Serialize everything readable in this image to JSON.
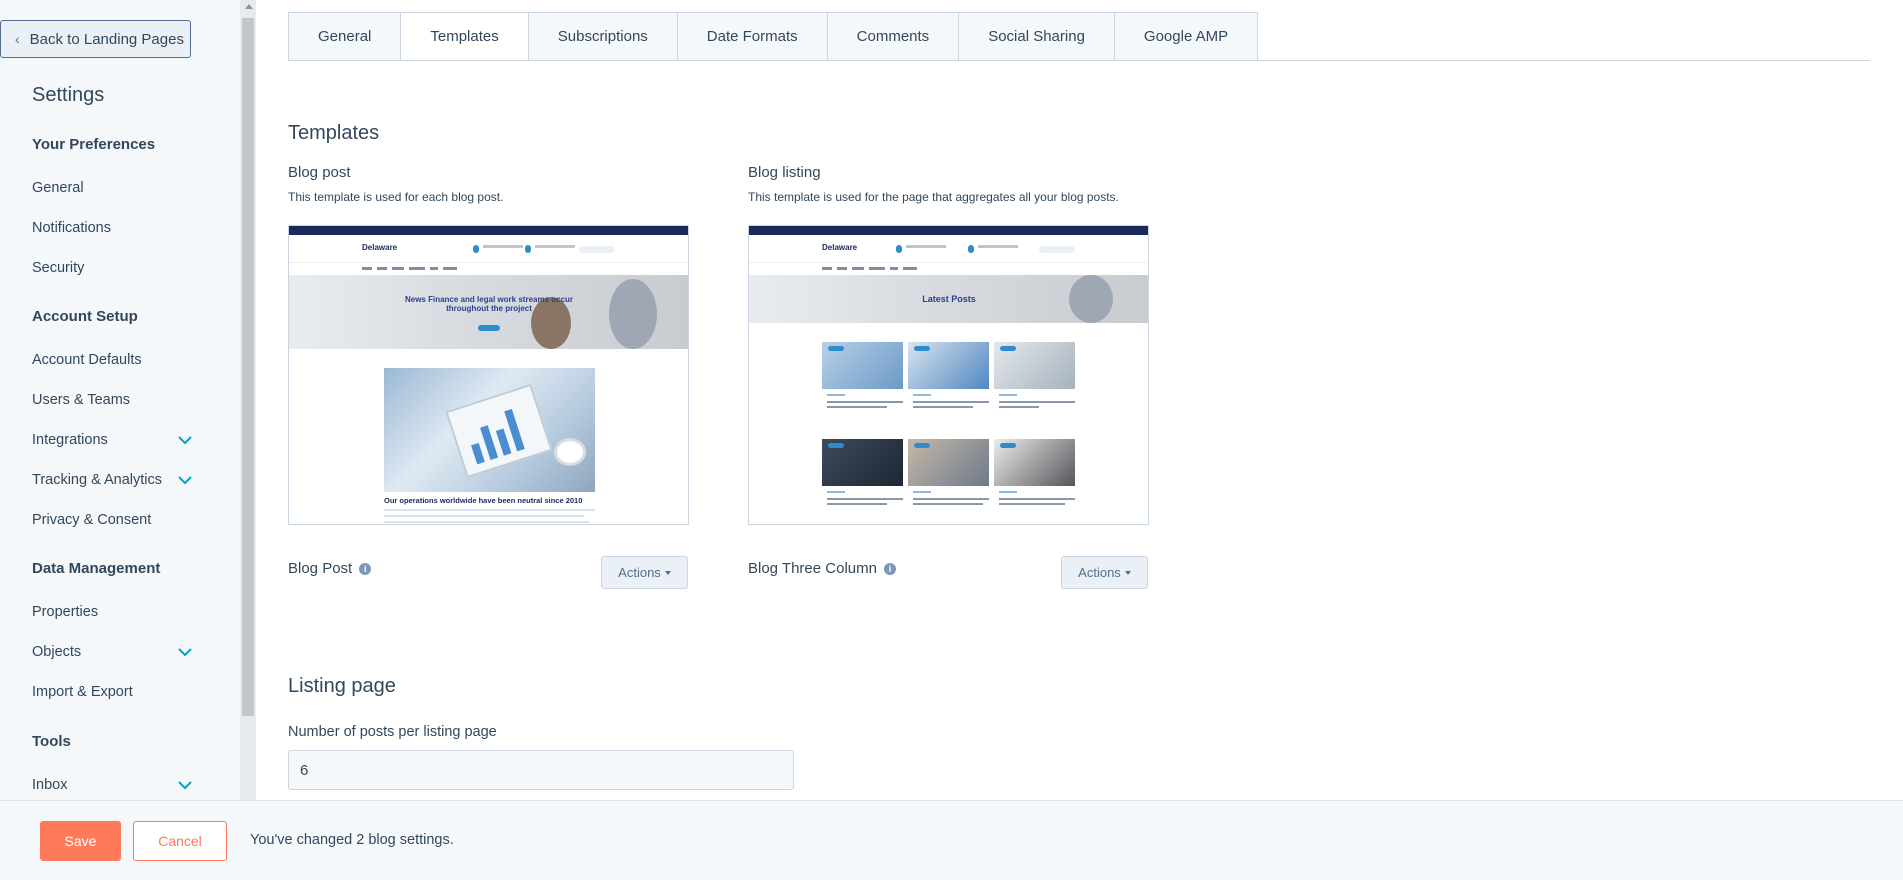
{
  "sidebar": {
    "back_label": "Back to Landing Pages",
    "title": "Settings",
    "sections": [
      {
        "heading": "Your Preferences",
        "items": [
          "General",
          "Notifications",
          "Security"
        ]
      },
      {
        "heading": "Account Setup",
        "items": [
          "Account Defaults",
          "Users & Teams",
          "Integrations",
          "Tracking & Analytics",
          "Privacy & Consent"
        ]
      },
      {
        "heading": "Data Management",
        "items": [
          "Properties",
          "Objects",
          "Import & Export"
        ]
      },
      {
        "heading": "Tools",
        "items": [
          "Inbox"
        ]
      }
    ]
  },
  "tabs": [
    "General",
    "Templates",
    "Subscriptions",
    "Date Formats",
    "Comments",
    "Social Sharing",
    "Google AMP"
  ],
  "active_tab": "Templates",
  "templates": {
    "heading": "Templates",
    "blog_post": {
      "title": "Blog post",
      "description": "This template is used for each blog post.",
      "template_name": "Blog Post",
      "actions_label": "Actions",
      "preview": {
        "logo": "Delaware",
        "hero_text": "News Finance and legal work streams occur throughout the project",
        "caption": "Our operations worldwide have been neutral since 2010"
      }
    },
    "blog_listing": {
      "title": "Blog listing",
      "description": "This template is used for the page that aggregates all your blog posts.",
      "template_name": "Blog Three Column",
      "actions_label": "Actions",
      "preview": {
        "logo": "Delaware",
        "hero_text": "Latest Posts"
      }
    }
  },
  "listing_page": {
    "heading": "Listing page",
    "posts_label": "Number of posts per listing page",
    "posts_value": "6"
  },
  "footer": {
    "save_label": "Save",
    "cancel_label": "Cancel",
    "message": "You've changed 2 blog settings."
  },
  "colors": {
    "accent": "#ff7a59",
    "text": "#33475b",
    "border": "#cbd6e2"
  }
}
